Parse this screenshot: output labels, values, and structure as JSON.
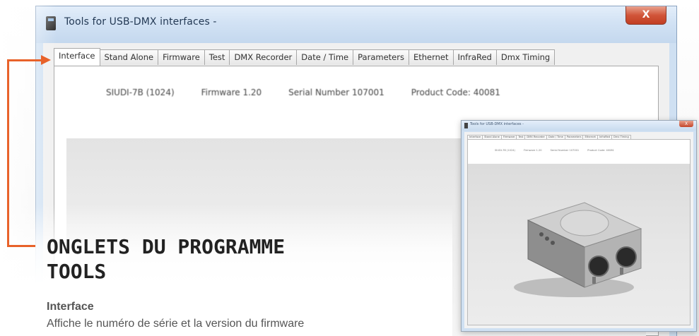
{
  "window": {
    "title": "Tools for USB-DMX interfaces -",
    "close_label": "X"
  },
  "tabs": [
    {
      "label": "Interface",
      "active": true
    },
    {
      "label": "Stand Alone",
      "active": false
    },
    {
      "label": "Firmware",
      "active": false
    },
    {
      "label": "Test",
      "active": false
    },
    {
      "label": "DMX Recorder",
      "active": false
    },
    {
      "label": "Date / Time",
      "active": false
    },
    {
      "label": "Parameters",
      "active": false
    },
    {
      "label": "Ethernet",
      "active": false
    },
    {
      "label": "InfraRed",
      "active": false
    },
    {
      "label": "Dmx Timing",
      "active": false
    }
  ],
  "interface_info": {
    "device": "SIUDI-7B (1024)",
    "firmware": "Firmware 1.20",
    "serial": "Serial Number 107001",
    "product_code": "Product Code: 40081"
  },
  "doc": {
    "headline_line1": "ONGLETS DU PROGRAMME",
    "headline_line2": "TOOLS",
    "subhead": "Interface",
    "description": "Affiche le numéro de série et la version du firmware"
  },
  "colors": {
    "accent": "#e8622a",
    "titlebar": "#cfe0f2",
    "close": "#c84a2e"
  }
}
